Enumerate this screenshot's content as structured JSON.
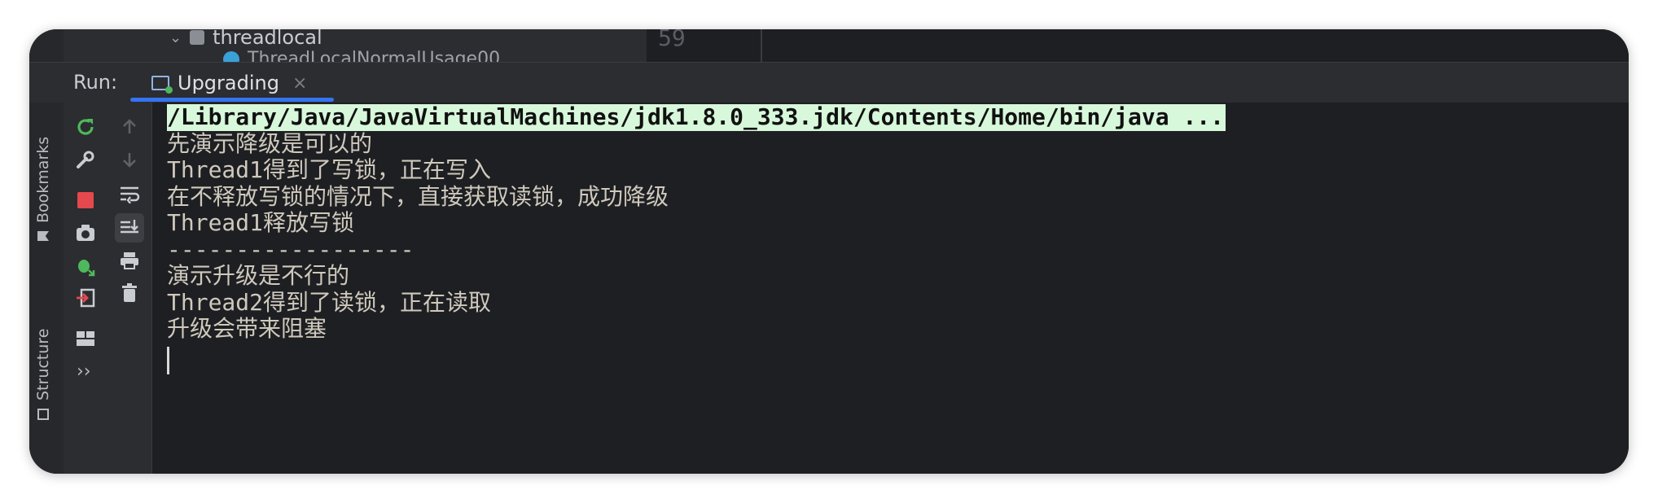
{
  "top_tree": {
    "row1_label": "threadlocal",
    "row2_label": "ThreadLocalNormalUsage00",
    "gutter_line": "59"
  },
  "run_panel": {
    "label": "Run:",
    "tab_label": "Upgrading",
    "tab_close": "×"
  },
  "side_tabs": {
    "bookmarks": "Bookmarks",
    "structure": "Structure"
  },
  "toolbar": {
    "more": "››"
  },
  "console": {
    "lines": [
      "/Library/Java/JavaVirtualMachines/jdk1.8.0_333.jdk/Contents/Home/bin/java ...",
      "先演示降级是可以的",
      "Thread1得到了写锁，正在写入",
      "在不释放写锁的情况下，直接获取读锁，成功降级",
      "Thread1释放写锁",
      "------------------",
      "演示升级是不行的",
      "Thread2得到了读锁，正在读取",
      "升级会带来阻塞"
    ]
  },
  "colors": {
    "accent": "#3574f0",
    "run_green": "#4fb85c",
    "stop_red": "#e5484d",
    "cmd_highlight": "#d7f8da"
  }
}
